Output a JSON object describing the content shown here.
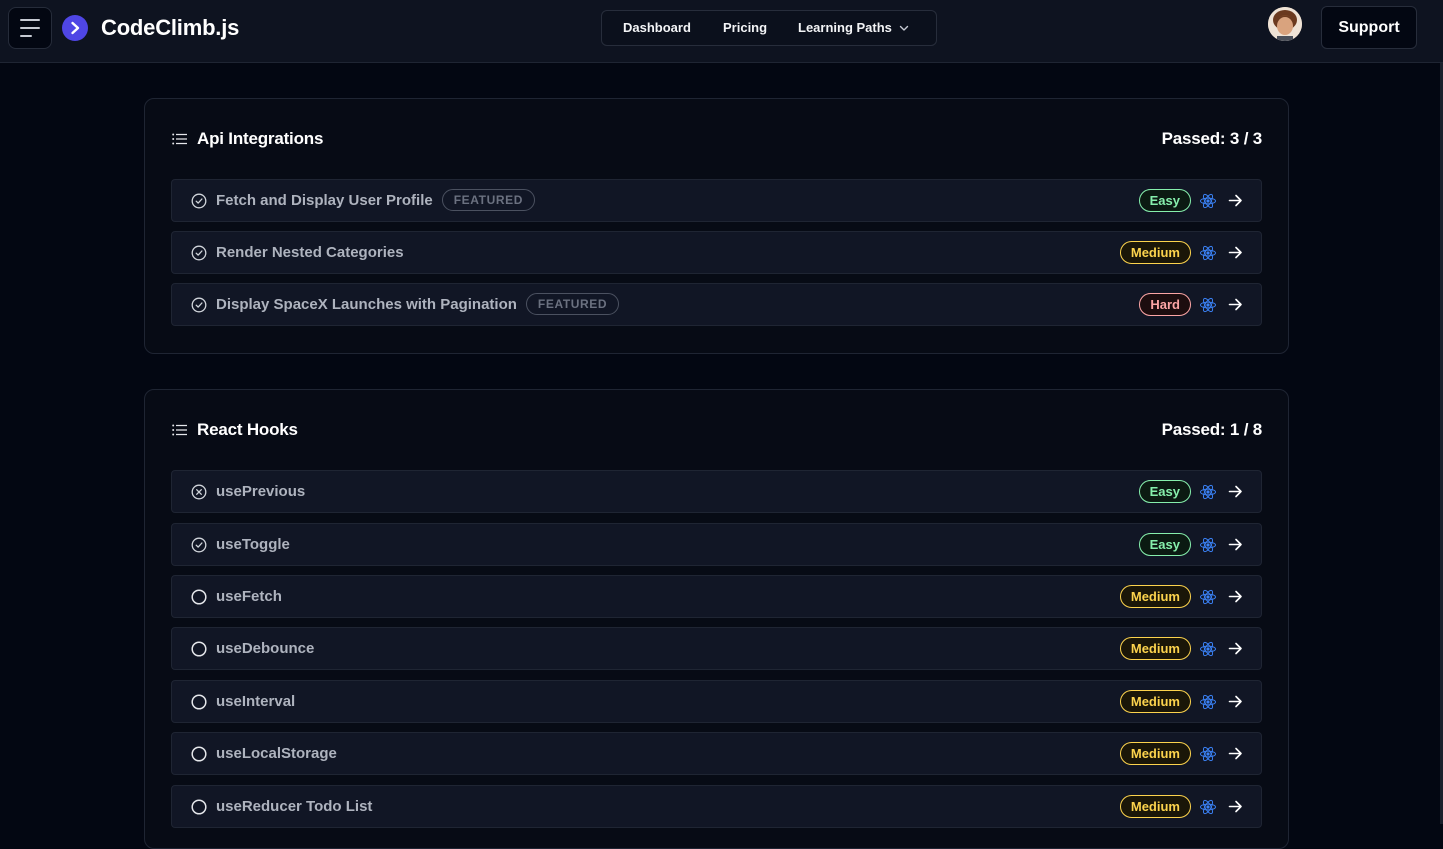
{
  "header": {
    "brand": "CodeClimb.js",
    "nav": [
      {
        "label": "Dashboard"
      },
      {
        "label": "Pricing"
      },
      {
        "label": "Learning Paths"
      }
    ],
    "support_label": "Support"
  },
  "colors": {
    "background": "#030712",
    "accent": "#4f46e5",
    "easy": "#86efac",
    "medium": "#fcd34d",
    "hard": "#fca5a5",
    "react": "#3b82f6"
  },
  "sections": [
    {
      "title": "Api Integrations",
      "passed": "Passed: 3 / 3",
      "items": [
        {
          "status": "passed",
          "title": "Fetch and Display User Profile",
          "tag": "FEATURED",
          "difficulty": "Easy"
        },
        {
          "status": "passed",
          "title": "Render Nested Categories",
          "tag": "",
          "difficulty": "Medium"
        },
        {
          "status": "passed",
          "title": "Display SpaceX Launches with Pagination",
          "tag": "FEATURED",
          "difficulty": "Hard"
        }
      ]
    },
    {
      "title": "React Hooks",
      "passed": "Passed: 1 / 8",
      "items": [
        {
          "status": "failed",
          "title": "usePrevious",
          "tag": "",
          "difficulty": "Easy"
        },
        {
          "status": "passed",
          "title": "useToggle",
          "tag": "",
          "difficulty": "Easy"
        },
        {
          "status": "none",
          "title": "useFetch",
          "tag": "",
          "difficulty": "Medium"
        },
        {
          "status": "none",
          "title": "useDebounce",
          "tag": "",
          "difficulty": "Medium"
        },
        {
          "status": "none",
          "title": "useInterval",
          "tag": "",
          "difficulty": "Medium"
        },
        {
          "status": "none",
          "title": "useLocalStorage",
          "tag": "",
          "difficulty": "Medium"
        },
        {
          "status": "none",
          "title": "useReducer Todo List",
          "tag": "",
          "difficulty": "Medium"
        }
      ]
    }
  ]
}
